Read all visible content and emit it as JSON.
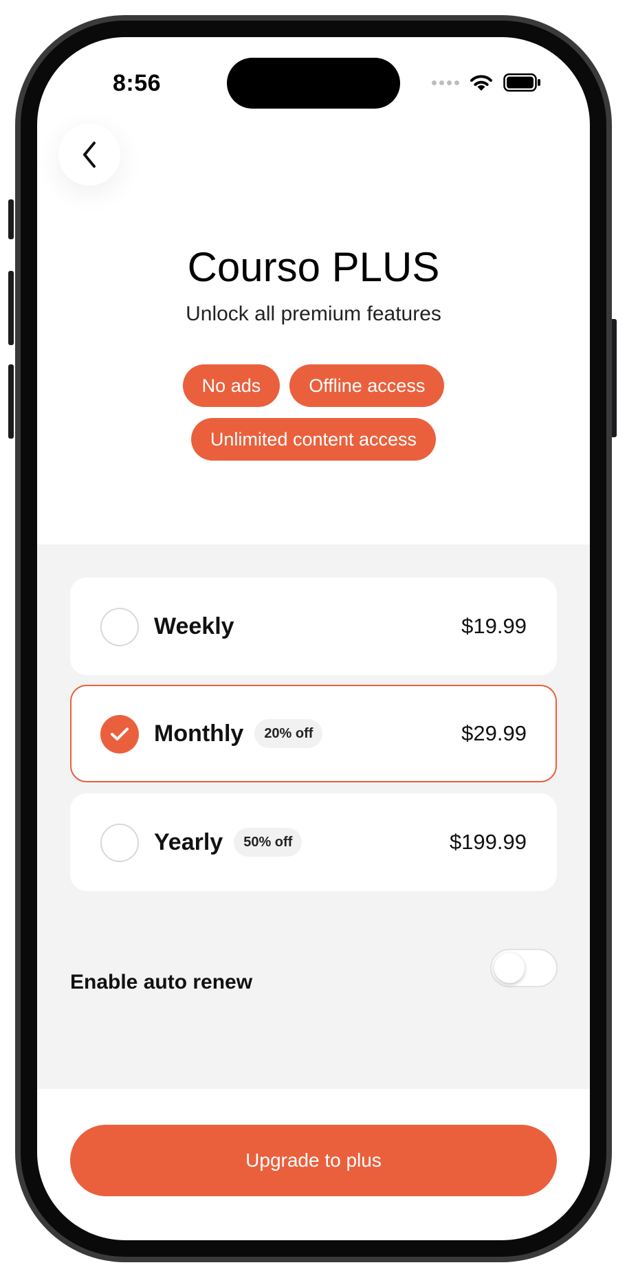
{
  "status_bar": {
    "time": "8:56"
  },
  "header": {
    "title": "Courso PLUS",
    "subtitle": "Unlock all premium features",
    "features": [
      "No ads",
      "Offline access",
      "Unlimited content access"
    ]
  },
  "plans": [
    {
      "name": "Weekly",
      "discount": "",
      "price": "$19.99",
      "selected": false
    },
    {
      "name": "Monthly",
      "discount": "20% off",
      "price": "$29.99",
      "selected": true
    },
    {
      "name": "Yearly",
      "discount": "50% off",
      "price": "$199.99",
      "selected": false
    }
  ],
  "auto_renew": {
    "label": "Enable auto renew",
    "enabled": false
  },
  "cta": {
    "label": "Upgrade to plus"
  },
  "colors": {
    "accent": "#ea603d",
    "section_bg": "#f3f3f3",
    "text": "#111111"
  },
  "icons": {
    "back": "chevron-left-icon",
    "check": "checkmark-icon",
    "wifi": "wifi-icon",
    "battery": "battery-icon",
    "signal": "cellular-signal-icon"
  }
}
